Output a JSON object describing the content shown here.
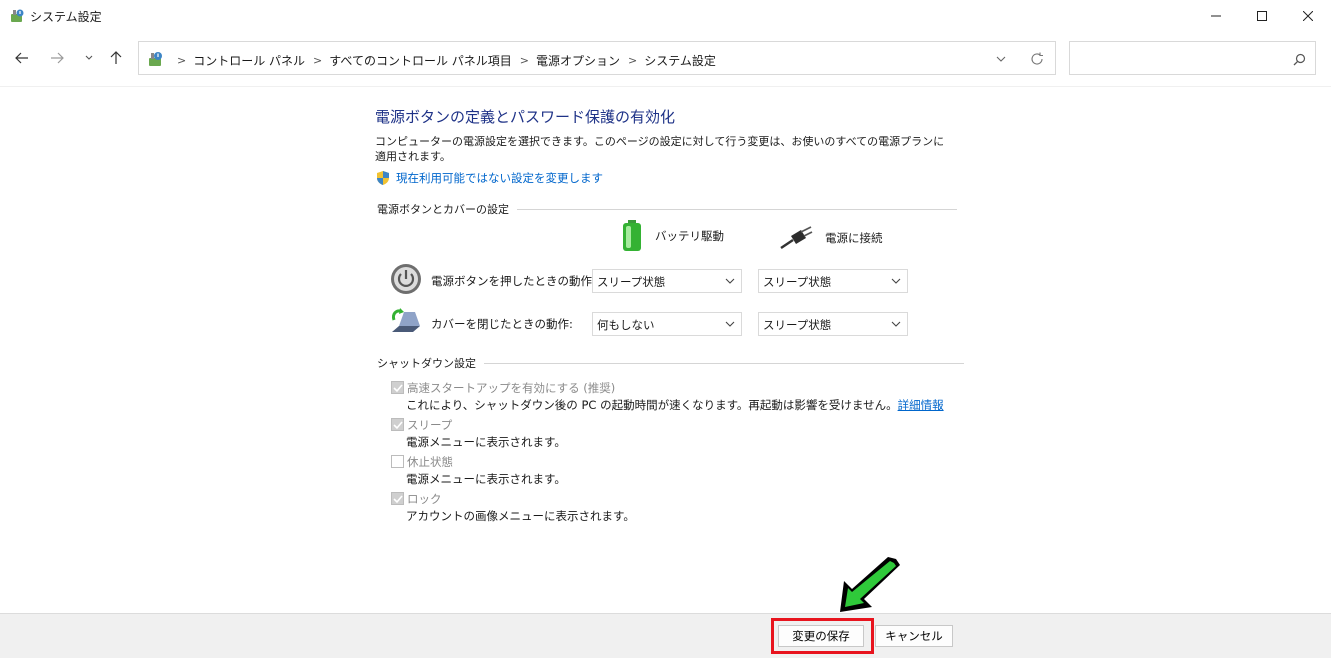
{
  "window": {
    "title": "システム設定",
    "icon": "power-options-icon"
  },
  "navigation": {
    "breadcrumbs": [
      "コントロール パネル",
      "すべてのコントロール パネル項目",
      "電源オプション",
      "システム設定"
    ],
    "search_placeholder": ""
  },
  "page": {
    "title": "電源ボタンの定義とパスワード保護の有効化",
    "description": "コンピューターの電源設定を選択できます。このページの設定に対して行う変更は、お使いのすべての電源プランに適用されます。",
    "change_link": "現在利用可能ではない設定を変更します"
  },
  "power_section": {
    "heading": "電源ボタンとカバーの設定",
    "column_battery": "バッテリ駆動",
    "column_plugged": "電源に接続",
    "rows": [
      {
        "label": "電源ボタンを押したときの動作:",
        "battery": "スリープ状態",
        "plugged": "スリープ状態"
      },
      {
        "label": "カバーを閉じたときの動作:",
        "battery": "何もしない",
        "plugged": "スリープ状態"
      }
    ]
  },
  "shutdown_section": {
    "heading": "シャットダウン設定",
    "items": [
      {
        "label": "高速スタートアップを有効にする (推奨)",
        "checked": true,
        "description": "これにより、シャットダウン後の PC の起動時間が速くなります。再起動は影響を受けません。",
        "link": "詳細情報"
      },
      {
        "label": "スリープ",
        "checked": true,
        "description": "電源メニューに表示されます。"
      },
      {
        "label": "休止状態",
        "checked": false,
        "description": "電源メニューに表示されます。"
      },
      {
        "label": "ロック",
        "checked": true,
        "description": "アカウントの画像メニューに表示されます。"
      }
    ]
  },
  "footer": {
    "save_label": "変更の保存",
    "cancel_label": "キャンセル"
  },
  "colors": {
    "title_blue": "#1e3287",
    "link_blue": "#0066cc",
    "highlight_red": "#e8141e",
    "arrow_green": "#2fc93a"
  }
}
